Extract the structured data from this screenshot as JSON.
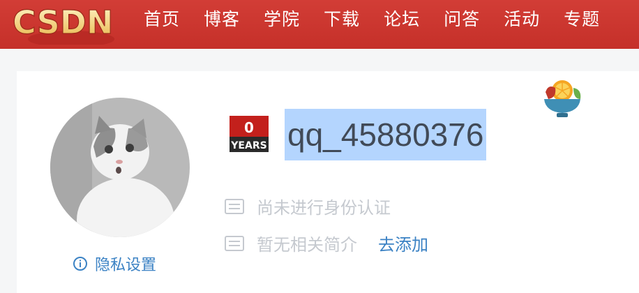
{
  "header": {
    "logo_text": "CSDN",
    "nav": [
      {
        "label": "首页"
      },
      {
        "label": "博客"
      },
      {
        "label": "学院"
      },
      {
        "label": "下载"
      },
      {
        "label": "论坛"
      },
      {
        "label": "问答"
      },
      {
        "label": "活动"
      },
      {
        "label": "专题"
      }
    ]
  },
  "profile": {
    "username": "qq_45880376",
    "badge": {
      "number": "0",
      "label": "YEARS"
    },
    "verification": "尚未进行身份认证",
    "intro": "暂无相关简介",
    "add_intro_link": "去添加",
    "privacy_link": "隐私设置",
    "avatar_icon": "cat-avatar",
    "corner_icon": "fruit-bowl-icon"
  },
  "colors": {
    "header_bg": "#c9302c",
    "link": "#3b82c4",
    "selection": "#b4d5fe",
    "muted_text": "#c5c9cf"
  }
}
